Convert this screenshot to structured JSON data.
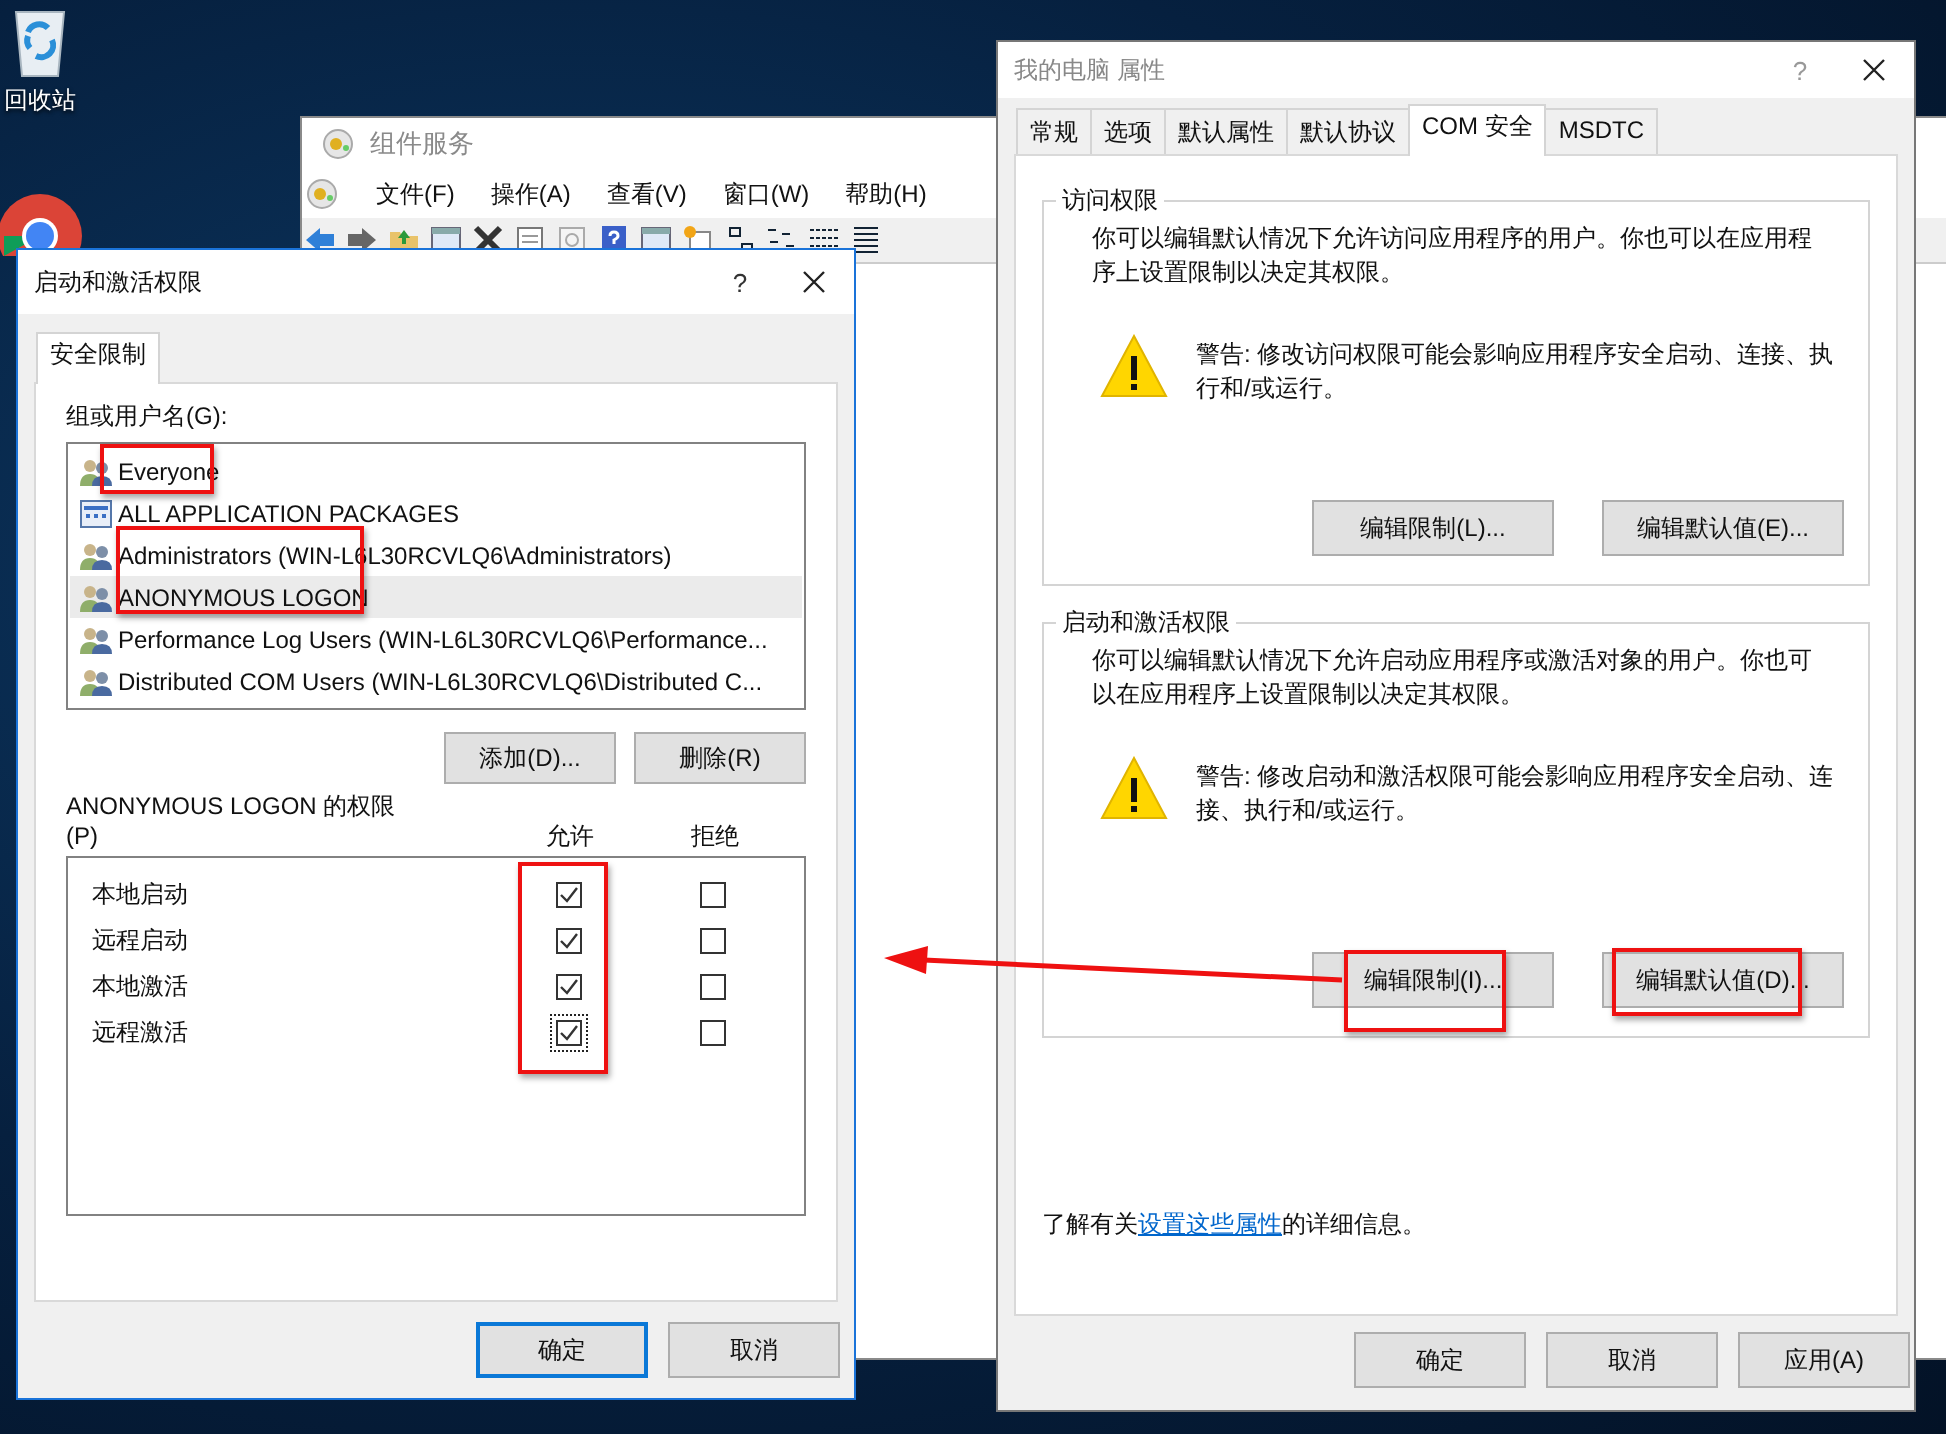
{
  "desktop_icons": [
    {
      "label": "回收站"
    }
  ],
  "background_window": {
    "title": "组件服务",
    "menu": [
      "文件(F)",
      "操作(A)",
      "查看(V)",
      "窗口(W)",
      "帮助(H)"
    ]
  },
  "properties_dialog": {
    "title": "我的电脑 属性",
    "help": "?",
    "tabs": [
      {
        "label": "常规",
        "selected": false
      },
      {
        "label": "选项",
        "selected": false
      },
      {
        "label": "默认属性",
        "selected": false
      },
      {
        "label": "默认协议",
        "selected": false
      },
      {
        "label": "COM 安全",
        "selected": true
      },
      {
        "label": "MSDTC",
        "selected": false
      }
    ],
    "groups": [
      {
        "title": "访问权限",
        "description": "你可以编辑默认情况下允许访问应用程序的用户。你也可以在应用程序上设置限制以决定其权限。",
        "warning": "警告: 修改访问权限可能会影响应用程序安全启动、连接、执行和/或运行。",
        "buttons": [
          "编辑限制(L)...",
          "编辑默认值(E)..."
        ]
      },
      {
        "title": "启动和激活权限",
        "description": "你可以编辑默认情况下允许启动应用程序或激活对象的用户。你也可以在应用程序上设置限制以决定其权限。",
        "warning": "警告: 修改启动和激活权限可能会影响应用程序安全启动、连接、执行和/或运行。",
        "buttons": [
          "编辑限制(I)...",
          "编辑默认值(D)..."
        ]
      }
    ],
    "footer_prefix": "了解有关",
    "footer_link": "设置这些属性",
    "footer_suffix": "的详细信息。",
    "buttons": [
      "确定",
      "取消",
      "应用(A)"
    ]
  },
  "permissions_dialog": {
    "title": "启动和激活权限",
    "help": "?",
    "tabs": [
      {
        "label": "安全限制",
        "selected": true
      }
    ],
    "users_label": "组或用户名(G):",
    "users": [
      {
        "name": "Everyone",
        "kind": "group",
        "selected": false
      },
      {
        "name": "ALL APPLICATION PACKAGES",
        "kind": "package",
        "selected": false
      },
      {
        "name": "Administrators (WIN-L6L30RCVLQ6\\Administrators)",
        "kind": "group",
        "selected": false
      },
      {
        "name": "ANONYMOUS LOGON",
        "kind": "group",
        "selected": true
      },
      {
        "name": "Performance Log Users (WIN-L6L30RCVLQ6\\Performance...",
        "kind": "group",
        "selected": false
      },
      {
        "name": "Distributed COM Users (WIN-L6L30RCVLQ6\\Distributed C...",
        "kind": "group",
        "selected": false
      }
    ],
    "user_buttons": [
      "添加(D)...",
      "删除(R)"
    ],
    "permissions_label": "ANONYMOUS LOGON 的权限",
    "permissions_key": "(P)",
    "columns": [
      "允许",
      "拒绝"
    ],
    "permissions": [
      {
        "name": "本地启动",
        "allow": true,
        "deny": false,
        "focused": false
      },
      {
        "name": "远程启动",
        "allow": true,
        "deny": false,
        "focused": false
      },
      {
        "name": "本地激活",
        "allow": true,
        "deny": false,
        "focused": false
      },
      {
        "name": "远程激活",
        "allow": true,
        "deny": false,
        "focused": true
      }
    ],
    "buttons": [
      {
        "label": "确定",
        "default": true
      },
      {
        "label": "取消",
        "default": false
      }
    ]
  }
}
